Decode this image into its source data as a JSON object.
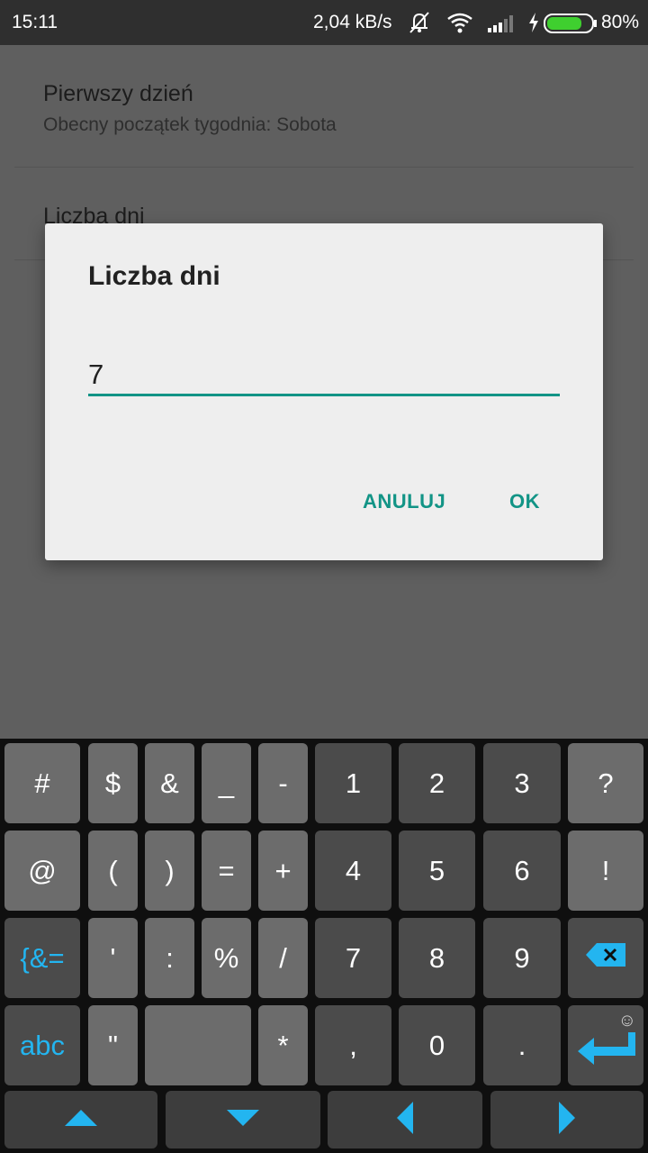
{
  "status_bar": {
    "time": "15:11",
    "network_speed": "2,04 kB/s",
    "battery_percent": "80%",
    "battery_level": 0.8,
    "icons": [
      "mute-icon",
      "wifi-icon",
      "signal-icon",
      "charging-icon",
      "battery-icon"
    ]
  },
  "settings": {
    "first_day": {
      "title": "Pierwszy dzień",
      "summary": "Obecny początek tygodnia: Sobota"
    },
    "days_count": {
      "title": "Liczba dni"
    }
  },
  "dialog": {
    "title": "Liczba dni",
    "input_value": "7",
    "cancel_label": "ANULUJ",
    "ok_label": "OK"
  },
  "keyboard": {
    "row1": [
      "#",
      "$",
      "&",
      "_",
      "-",
      "1",
      "2",
      "3",
      "?"
    ],
    "row2": [
      "@",
      "(",
      ")",
      "=",
      "+",
      "4",
      "5",
      "6",
      "!"
    ],
    "row3": [
      "{&=",
      "'",
      ":",
      "%",
      "/",
      "7",
      "8",
      "9",
      "backspace-icon"
    ],
    "row4": [
      "abc",
      "\"",
      "space",
      "*",
      ",",
      "0",
      ".",
      "enter-icon"
    ],
    "row5": [
      "arrow-up-icon",
      "arrow-down-icon",
      "arrow-left-icon",
      "arrow-right-icon"
    ]
  },
  "colors": {
    "accent": "#129486",
    "keyboard_accent": "#23b5f0",
    "status_bar": "#2f2f2f",
    "dialog_bg": "#eeeeee"
  }
}
